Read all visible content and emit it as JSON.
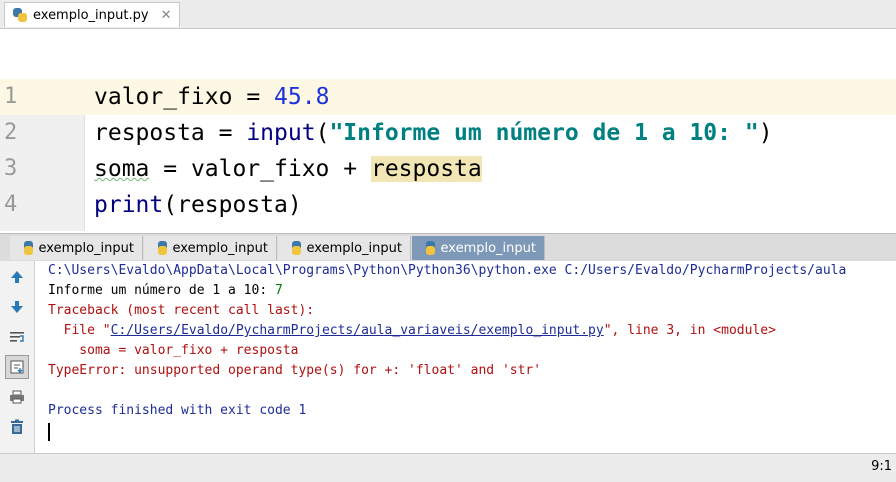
{
  "editor_tab": {
    "label": "exemplo_input.py",
    "close": "✕"
  },
  "code_lines": [
    {
      "num": "1",
      "parts": {
        "a": "valor_fixo",
        "b": " = ",
        "c": "45.8"
      }
    },
    {
      "num": "2",
      "parts": {
        "a": "resposta",
        "b": " = ",
        "c": "input",
        "d": "(",
        "e": "\"Informe um número de 1 a 10: \"",
        "f": ")"
      }
    },
    {
      "num": "3",
      "parts": {
        "a": "soma",
        "b": " = ",
        "c": "valor_fixo",
        "d": " + ",
        "e": "resposta"
      }
    },
    {
      "num": "4",
      "parts": {
        "a": "print",
        "b": "(resposta)"
      }
    }
  ],
  "run_tabs": [
    "exemplo_input",
    "exemplo_input",
    "exemplo_input",
    "exemplo_input"
  ],
  "console": {
    "cmd": "C:\\Users\\Evaldo\\AppData\\Local\\Programs\\Python\\Python36\\python.exe C:/Users/Evaldo/PycharmProjects/aula",
    "prompt": "Informe um número de 1 a 10: ",
    "input_value": "7",
    "traceback": "Traceback (most recent call last):",
    "file_prefix": "  File \"",
    "file_link": "C:/Users/Evaldo/PycharmProjects/aula_variaveis/exemplo_input.py",
    "file_suffix": "\", line 3, in <module>",
    "source_line": "    soma = valor_fixo + resposta",
    "error": "TypeError: unsupported operand type(s) for +: 'float' and 'str'",
    "exit": "Process finished with exit code 1"
  },
  "status": {
    "position": "9:1"
  }
}
